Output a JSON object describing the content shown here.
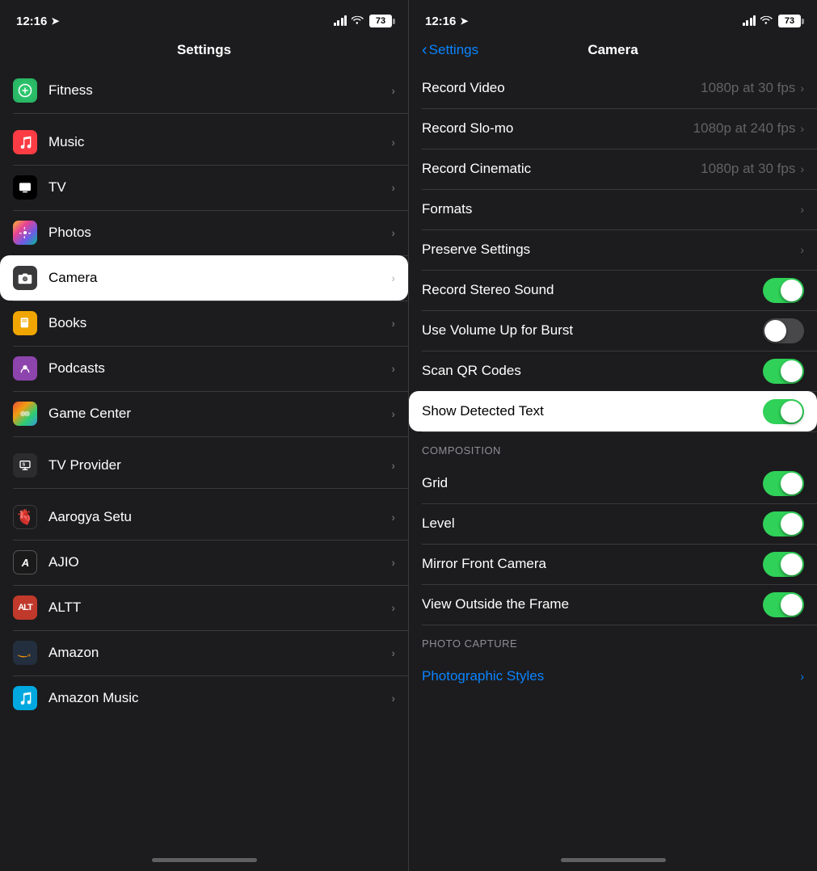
{
  "left": {
    "statusBar": {
      "time": "12:16",
      "battery": "73"
    },
    "header": {
      "title": "Settings"
    },
    "items": [
      {
        "id": "fitness",
        "label": "Fitness",
        "iconBg": "#000",
        "iconEmoji": "🎯",
        "iconColor": "#30d158",
        "highlighted": false
      },
      {
        "id": "music",
        "label": "Music",
        "iconBg": "#fc3c44",
        "iconEmoji": "🎵",
        "highlighted": false
      },
      {
        "id": "tv",
        "label": "TV",
        "iconBg": "#000",
        "iconEmoji": "📺",
        "highlighted": false
      },
      {
        "id": "photos",
        "label": "Photos",
        "iconBg": "#fff",
        "iconEmoji": "🌸",
        "highlighted": false
      },
      {
        "id": "camera",
        "label": "Camera",
        "iconBg": "#3a3a3c",
        "iconEmoji": "📷",
        "highlighted": true
      },
      {
        "id": "books",
        "label": "Books",
        "iconBg": "#f0a500",
        "iconEmoji": "📚",
        "highlighted": false
      },
      {
        "id": "podcasts",
        "label": "Podcasts",
        "iconBg": "#8e44ad",
        "iconEmoji": "🎙️",
        "highlighted": false
      },
      {
        "id": "gamecenter",
        "label": "Game Center",
        "iconBg": "#1c1c1e",
        "iconEmoji": "🎮",
        "highlighted": false
      },
      {
        "id": "tvprovider",
        "label": "TV Provider",
        "iconBg": "#2c2c2e",
        "iconEmoji": "📡",
        "highlighted": false
      },
      {
        "id": "aarogyasetu",
        "label": "Aarogya Setu",
        "iconBg": "#1c1c1e",
        "iconEmoji": "❤️",
        "highlighted": false
      },
      {
        "id": "ajio",
        "label": "AJIO",
        "iconBg": "#1a1a1a",
        "iconEmoji": "🅰",
        "highlighted": false
      },
      {
        "id": "altt",
        "label": "ALTT",
        "iconBg": "#e74c3c",
        "iconEmoji": "▶",
        "highlighted": false
      },
      {
        "id": "amazon",
        "label": "Amazon",
        "iconBg": "#232f3e",
        "iconEmoji": "📦",
        "highlighted": false
      },
      {
        "id": "amazonmusic",
        "label": "Amazon Music",
        "iconBg": "#00a8e0",
        "iconEmoji": "🎶",
        "highlighted": false
      }
    ]
  },
  "right": {
    "statusBar": {
      "time": "12:16",
      "battery": "73"
    },
    "header": {
      "title": "Camera",
      "backLabel": "Settings"
    },
    "items": [
      {
        "id": "record-video",
        "label": "Record Video",
        "value": "1080p at 30 fps",
        "type": "chevron",
        "highlighted": false
      },
      {
        "id": "record-slomo",
        "label": "Record Slo-mo",
        "value": "1080p at 240 fps",
        "type": "chevron",
        "highlighted": false
      },
      {
        "id": "record-cinematic",
        "label": "Record Cinematic",
        "value": "1080p at 30 fps",
        "type": "chevron",
        "highlighted": false
      },
      {
        "id": "formats",
        "label": "Formats",
        "value": "",
        "type": "chevron",
        "highlighted": false
      },
      {
        "id": "preserve-settings",
        "label": "Preserve Settings",
        "value": "",
        "type": "chevron",
        "highlighted": false
      },
      {
        "id": "record-stereo",
        "label": "Record Stereo Sound",
        "value": "",
        "type": "toggle",
        "toggleOn": true,
        "highlighted": false
      },
      {
        "id": "volume-up-burst",
        "label": "Use Volume Up for Burst",
        "value": "",
        "type": "toggle",
        "toggleOn": false,
        "highlighted": false
      },
      {
        "id": "scan-qr",
        "label": "Scan QR Codes",
        "value": "",
        "type": "toggle",
        "toggleOn": true,
        "highlighted": false
      },
      {
        "id": "show-detected",
        "label": "Show Detected Text",
        "value": "",
        "type": "toggle",
        "toggleOn": true,
        "highlighted": true
      }
    ],
    "compositionSection": {
      "label": "COMPOSITION",
      "items": [
        {
          "id": "grid",
          "label": "Grid",
          "type": "toggle",
          "toggleOn": true
        },
        {
          "id": "level",
          "label": "Level",
          "type": "toggle",
          "toggleOn": true
        },
        {
          "id": "mirror-front",
          "label": "Mirror Front Camera",
          "type": "toggle",
          "toggleOn": true
        },
        {
          "id": "view-outside",
          "label": "View Outside the Frame",
          "type": "toggle",
          "toggleOn": true
        }
      ]
    },
    "photoCaptureSection": {
      "label": "PHOTO CAPTURE",
      "items": [
        {
          "id": "photographic-styles",
          "label": "Photographic Styles",
          "type": "chevron",
          "isBlue": true
        }
      ]
    }
  }
}
